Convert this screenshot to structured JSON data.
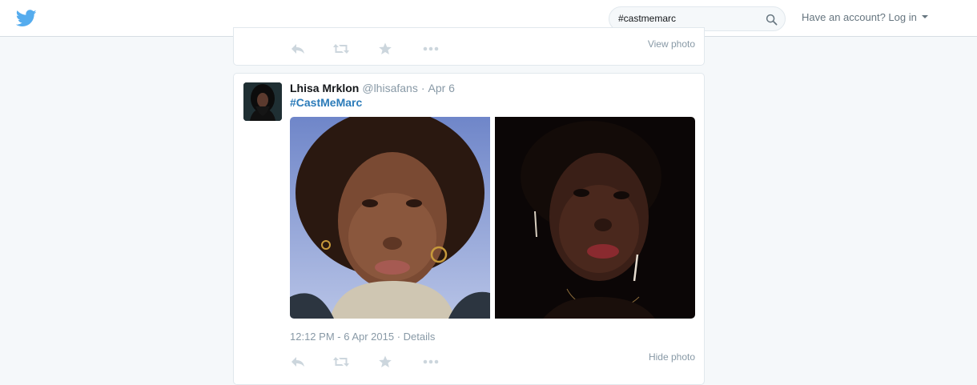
{
  "header": {
    "logo_icon": "twitter-bird-icon",
    "search": {
      "value": "#castmemarc",
      "icon": "search-icon"
    },
    "login_prompt": "Have an account? Log in"
  },
  "tweets": [
    {
      "partial": true,
      "photo_toggle": "View photo",
      "actions": [
        "reply-icon",
        "retweet-icon",
        "favorite-icon",
        "more-icon"
      ]
    },
    {
      "fullname": "Lhisa Mrklon",
      "username": "@lhisafans",
      "separator": "·",
      "date": "Apr 6",
      "hashtag": "#CastMeMarc",
      "photos": [
        "photo-1",
        "photo-2"
      ],
      "timestamp": "12:12 PM - 6 Apr 2015 · Details",
      "photo_toggle": "Hide photo",
      "actions": [
        "reply-icon",
        "retweet-icon",
        "favorite-icon",
        "more-icon"
      ]
    }
  ],
  "colors": {
    "brand": "#1da1f2",
    "link": "#2b7bb9",
    "muted": "#8899a6",
    "icon": "#ccd6dd"
  }
}
